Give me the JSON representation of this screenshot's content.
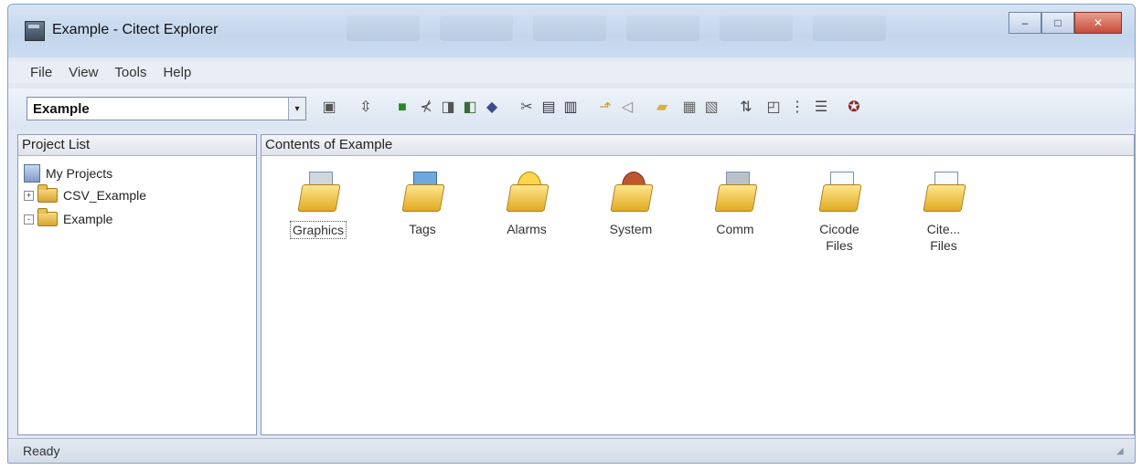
{
  "window": {
    "title": "Example - Citect Explorer"
  },
  "title_buttons": {
    "minimize": "–",
    "maximize": "□",
    "close": "✕"
  },
  "menu": [
    "File",
    "View",
    "Tools",
    "Help"
  ],
  "toolbar": {
    "project_selector": "Example",
    "dropdown_glyph": "▾"
  },
  "left_pane": {
    "header": "Project List",
    "root": "My Projects",
    "items": [
      {
        "label": "CSV_Example",
        "expander": "+"
      },
      {
        "label": "Example",
        "expander": "-"
      }
    ]
  },
  "right_pane": {
    "header": "Contents of Example",
    "items": [
      {
        "label": "Graphics"
      },
      {
        "label": "Tags"
      },
      {
        "label": "Alarms"
      },
      {
        "label": "System"
      },
      {
        "label": "Comm"
      },
      {
        "label": "Cicode Files"
      },
      {
        "label": "Cite... Files"
      }
    ]
  },
  "status": {
    "text": "Ready"
  },
  "colors": {
    "accent": "#c84a3a",
    "folder": "#e0aa22",
    "titlebar": "#c4d6ec"
  }
}
